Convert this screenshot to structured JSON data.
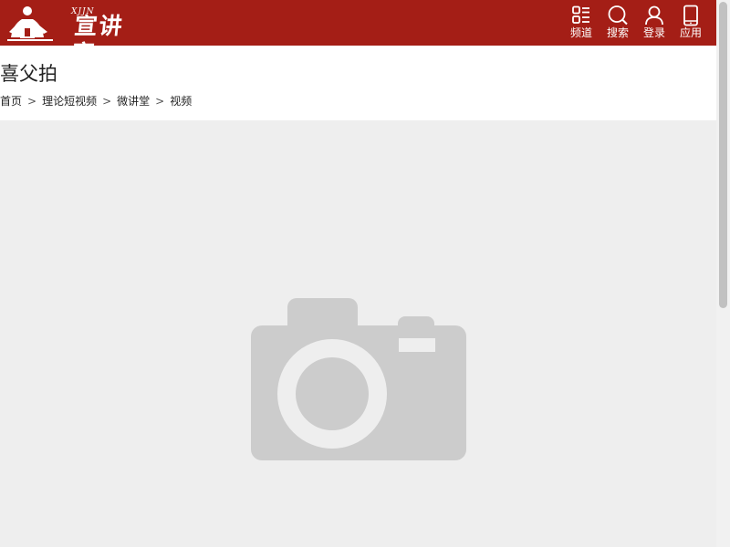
{
  "header": {
    "brand_name": "宣讲家",
    "brand_mark": "XJJN",
    "colors": {
      "bar": "#a41e16",
      "text": "#ffffff"
    },
    "nav": [
      {
        "label": "频道",
        "icon": "grid-list-icon"
      },
      {
        "label": "搜索",
        "icon": "search-icon"
      },
      {
        "label": "登录",
        "icon": "user-icon"
      },
      {
        "label": "应用",
        "icon": "phone-icon"
      }
    ]
  },
  "main": {
    "title": "喜父拍",
    "breadcrumb": [
      {
        "label": "首页"
      },
      {
        "label": "理论短视频"
      },
      {
        "label": "微讲堂"
      },
      {
        "label": "视频"
      }
    ],
    "breadcrumb_separator": ">",
    "video": {
      "placeholder_icon": "camera-placeholder-icon",
      "colors": {
        "background": "#eeeeee",
        "icon": "#cccccc"
      }
    }
  }
}
